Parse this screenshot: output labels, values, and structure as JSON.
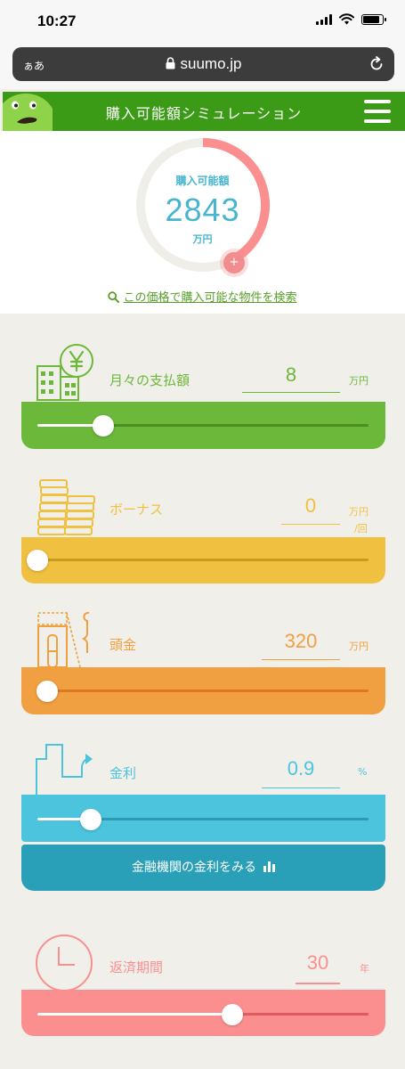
{
  "status_bar": {
    "time": "10:27"
  },
  "browser": {
    "aa_label": "ぁあ",
    "url": "suumo.jp"
  },
  "header": {
    "title": "購入可能額シミュレーション"
  },
  "gauge": {
    "caption": "購入可能額",
    "value": "2843",
    "unit": "万円",
    "plus_label": "+",
    "search_link": "この価格で購入可能な物件を検索",
    "fill_fraction": 0.41
  },
  "sections": [
    {
      "label": "月々の支払額",
      "value": "8",
      "unit": "万円",
      "color": "#6cb83a",
      "slider_fraction": 0.2
    },
    {
      "label": "ボーナス",
      "value": "0",
      "unit": "万円",
      "unit2": "/回",
      "color": "#f0c040",
      "slider_fraction": 0.0
    },
    {
      "label": "頭金",
      "value": "320",
      "unit": "万円",
      "color": "#f0a040",
      "slider_fraction": 0.03
    },
    {
      "label": "金利",
      "value": "0.9",
      "unit": "%",
      "color": "#4dc4de",
      "slider_fraction": 0.16
    },
    {
      "label": "返済期間",
      "value": "30",
      "unit": "年",
      "color": "#fb8f90",
      "slider_fraction": 0.59
    }
  ],
  "rates_button": {
    "label": "金融機関の金利をみる"
  },
  "icons": [
    "lock-icon",
    "reload-icon",
    "menu-icon",
    "search-icon",
    "yen-building-icon",
    "coins-icon",
    "house-key-icon",
    "rate-graph-icon",
    "clock-icon",
    "bar-chart-icon"
  ]
}
